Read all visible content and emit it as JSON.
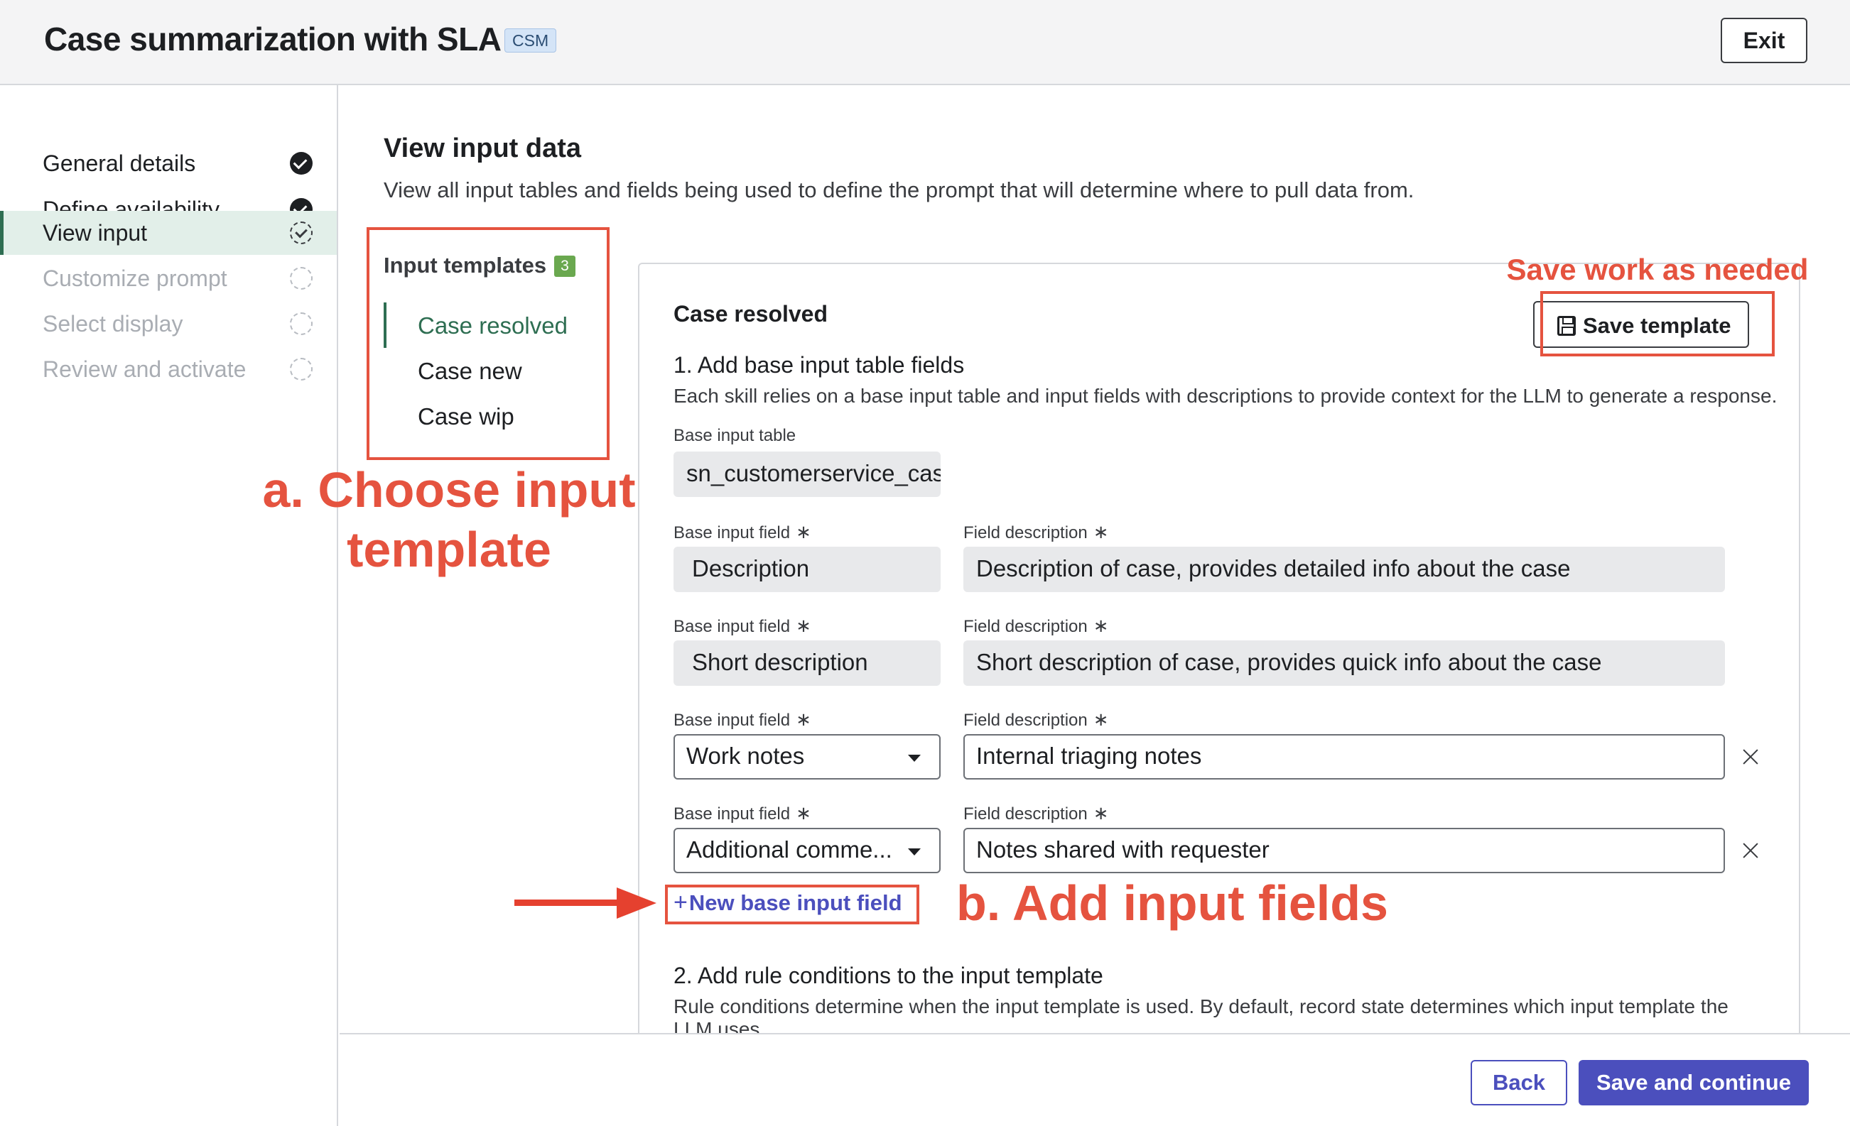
{
  "header": {
    "title": "Case summarization with SLA",
    "badge": "CSM",
    "exit_label": "Exit"
  },
  "sidebar": {
    "items": [
      {
        "label": "General details",
        "status": "complete"
      },
      {
        "label": "Define availability",
        "status": "complete"
      },
      {
        "label": "View input",
        "status": "current"
      },
      {
        "label": "Customize prompt",
        "status": "pending"
      },
      {
        "label": "Select display",
        "status": "pending"
      },
      {
        "label": "Review and activate",
        "status": "pending"
      }
    ]
  },
  "main": {
    "title": "View input data",
    "subtitle": "View all input tables and fields being used to define the prompt that will determine where to pull data from.",
    "templates": {
      "title": "Input templates",
      "count": "3",
      "items": [
        "Case resolved",
        "Case new",
        "Case wip"
      ]
    },
    "card": {
      "title": "Case resolved",
      "save_template_label": "Save template",
      "step1_title": "1. Add base input table fields",
      "step1_desc": "Each skill relies on a base input table and input fields with descriptions to provide context for the LLM to generate a response.",
      "base_table_label": "Base input table",
      "base_table_value": "sn_customerservice_cas",
      "field_label": "Base input field",
      "desc_label": "Field description",
      "required_mark": "∗",
      "rows": [
        {
          "field": "Description",
          "description": "Description of case, provides detailed info about the case",
          "editable": false
        },
        {
          "field": "Short description",
          "description": "Short description of case, provides quick info about the case",
          "editable": false
        },
        {
          "field": "Work notes",
          "description": "Internal triaging notes",
          "editable": true
        },
        {
          "field": "Additional comme...",
          "description": "Notes shared with requester",
          "editable": true
        }
      ],
      "new_field_label": "New base input field",
      "step2_title": "2. Add rule conditions to the input template",
      "step2_desc": "Rule conditions determine when the input template is used. By default, record state determines which input template the LLM uses."
    }
  },
  "footer": {
    "back_label": "Back",
    "save_continue_label": "Save and continue"
  },
  "annotations": {
    "save_work": "Save work as needed",
    "choose_template": "a. Choose input template",
    "add_fields": "b. Add input fields"
  },
  "colors": {
    "accent": "#4b4fbd",
    "active_green": "#2e6e52",
    "annotation_red": "#e5533f"
  }
}
